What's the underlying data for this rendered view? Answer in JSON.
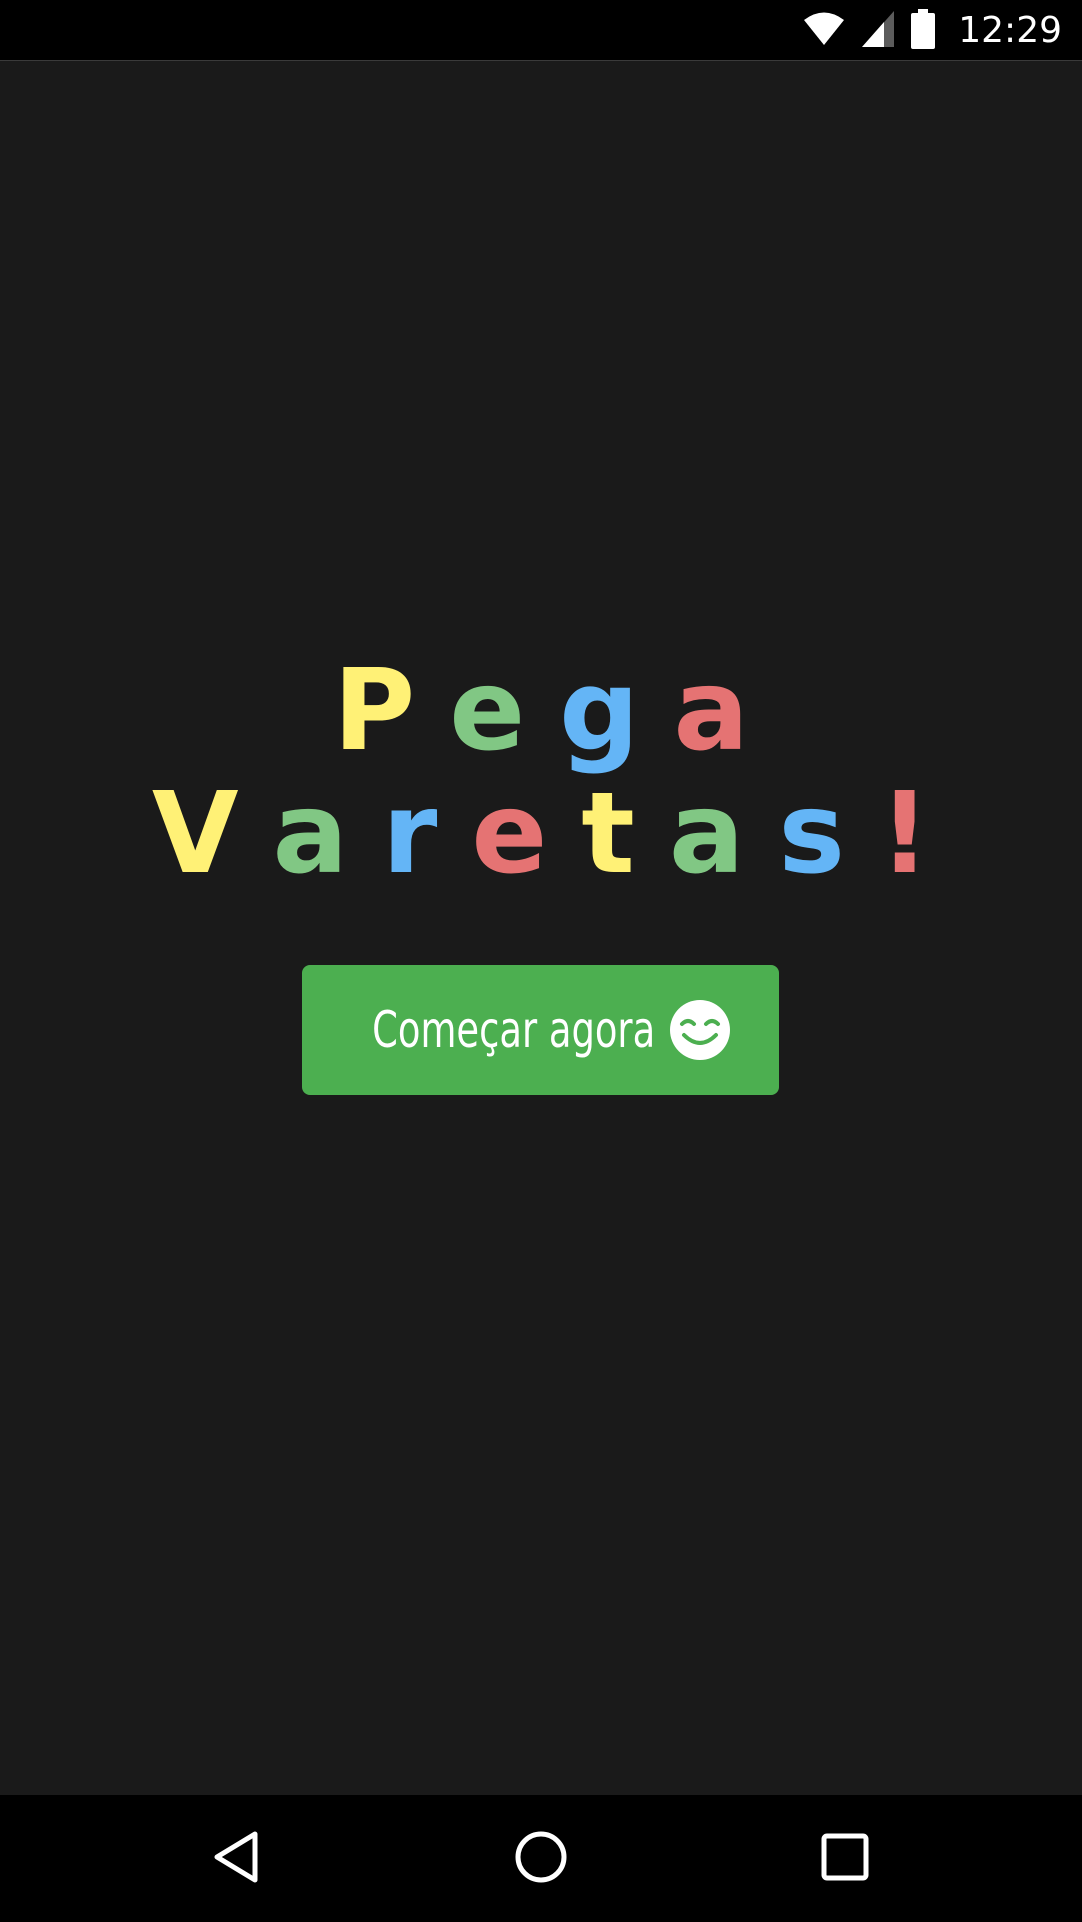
{
  "status_bar": {
    "time": "12:29",
    "icons": [
      "wifi-icon",
      "cell-signal-icon",
      "battery-icon"
    ]
  },
  "title": {
    "line1": [
      {
        "char": "P",
        "color": "#fff176"
      },
      {
        "char": "e",
        "color": "#81c784"
      },
      {
        "char": "g",
        "color": "#64b5f6"
      },
      {
        "char": "a",
        "color": "#e57373"
      }
    ],
    "line2": [
      {
        "char": "V",
        "color": "#fff176"
      },
      {
        "char": "a",
        "color": "#81c784"
      },
      {
        "char": "r",
        "color": "#64b5f6"
      },
      {
        "char": "e",
        "color": "#e57373"
      },
      {
        "char": "t",
        "color": "#fff176"
      },
      {
        "char": "a",
        "color": "#81c784"
      },
      {
        "char": "s",
        "color": "#64b5f6"
      },
      {
        "char": "!",
        "color": "#e57373"
      }
    ]
  },
  "start_button": {
    "label": "Começar agora",
    "icon": "smile-icon",
    "color": "#4caf50"
  },
  "nav_bar": {
    "buttons": [
      "back-icon",
      "home-icon",
      "recents-icon"
    ]
  },
  "colors": {
    "background": "#1a1a1a",
    "bars": "#000000"
  }
}
